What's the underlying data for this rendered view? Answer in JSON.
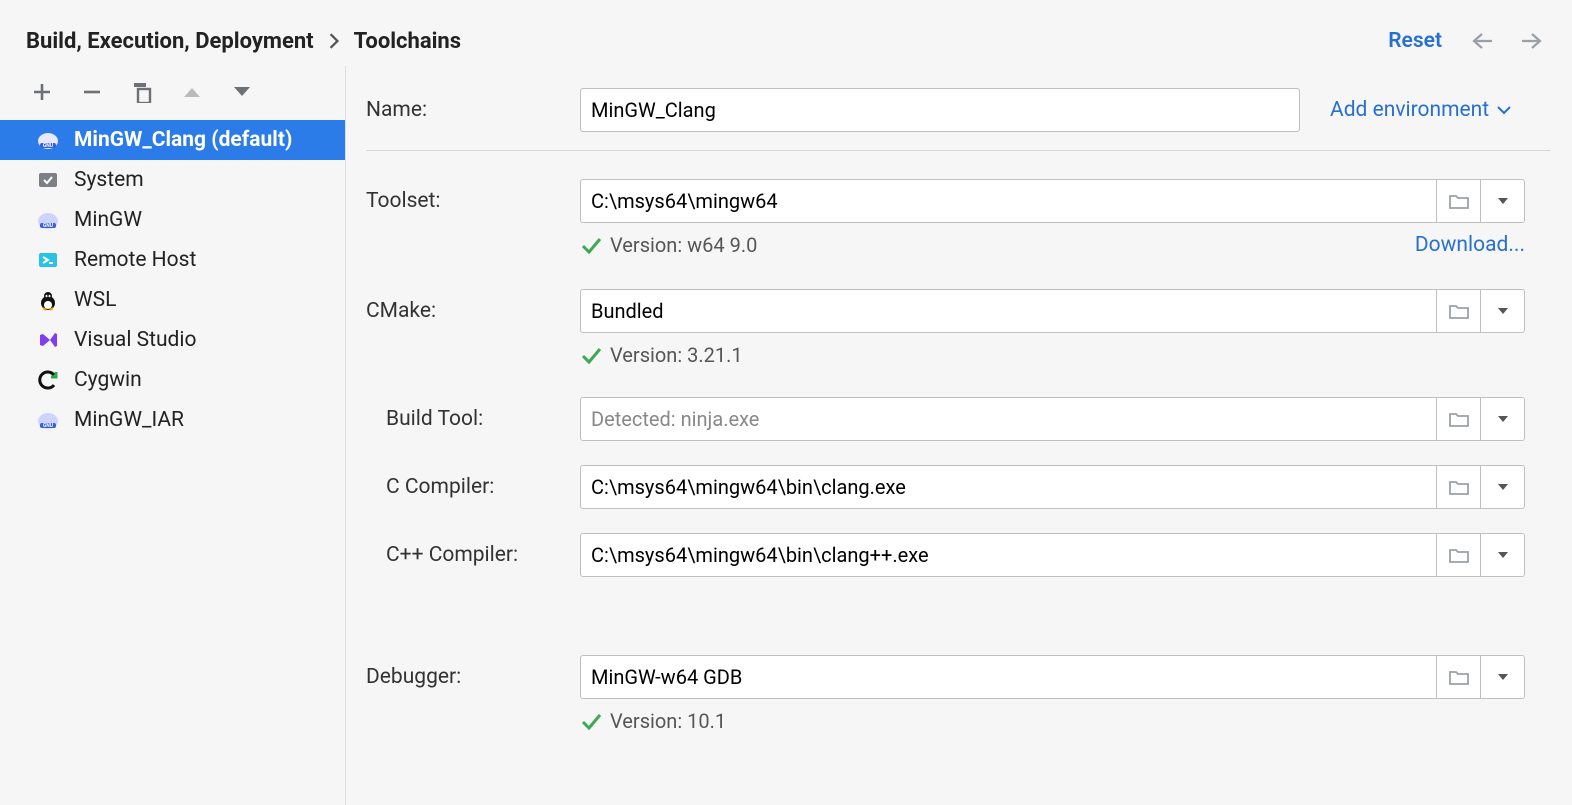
{
  "breadcrumb": {
    "parent": "Build, Execution, Deployment",
    "current": "Toolchains"
  },
  "header": {
    "reset_label": "Reset"
  },
  "sidebar": {
    "items": [
      {
        "label": "MinGW_Clang (default)",
        "icon": "gnu"
      },
      {
        "label": "System",
        "icon": "system"
      },
      {
        "label": "MinGW",
        "icon": "gnu"
      },
      {
        "label": "Remote Host",
        "icon": "remote"
      },
      {
        "label": "WSL",
        "icon": "tux"
      },
      {
        "label": "Visual Studio",
        "icon": "vs"
      },
      {
        "label": "Cygwin",
        "icon": "cygwin"
      },
      {
        "label": "MinGW_IAR",
        "icon": "gnu"
      }
    ]
  },
  "form": {
    "name_label": "Name:",
    "name_value": "MinGW_Clang",
    "add_env_label": "Add environment",
    "toolset_label": "Toolset:",
    "toolset_value": "C:\\msys64\\mingw64",
    "toolset_version": "Version: w64 9.0",
    "download_label": "Download...",
    "cmake_label": "CMake:",
    "cmake_value": "Bundled",
    "cmake_version": "Version: 3.21.1",
    "buildtool_label": "Build Tool:",
    "buildtool_placeholder": "Detected: ninja.exe",
    "c_label": "C Compiler:",
    "c_value": "C:\\msys64\\mingw64\\bin\\clang.exe",
    "cpp_label": "C++ Compiler:",
    "cpp_value": "C:\\msys64\\mingw64\\bin\\clang++.exe",
    "debugger_label": "Debugger:",
    "debugger_value": "MinGW-w64 GDB",
    "debugger_version": "Version: 10.1"
  }
}
